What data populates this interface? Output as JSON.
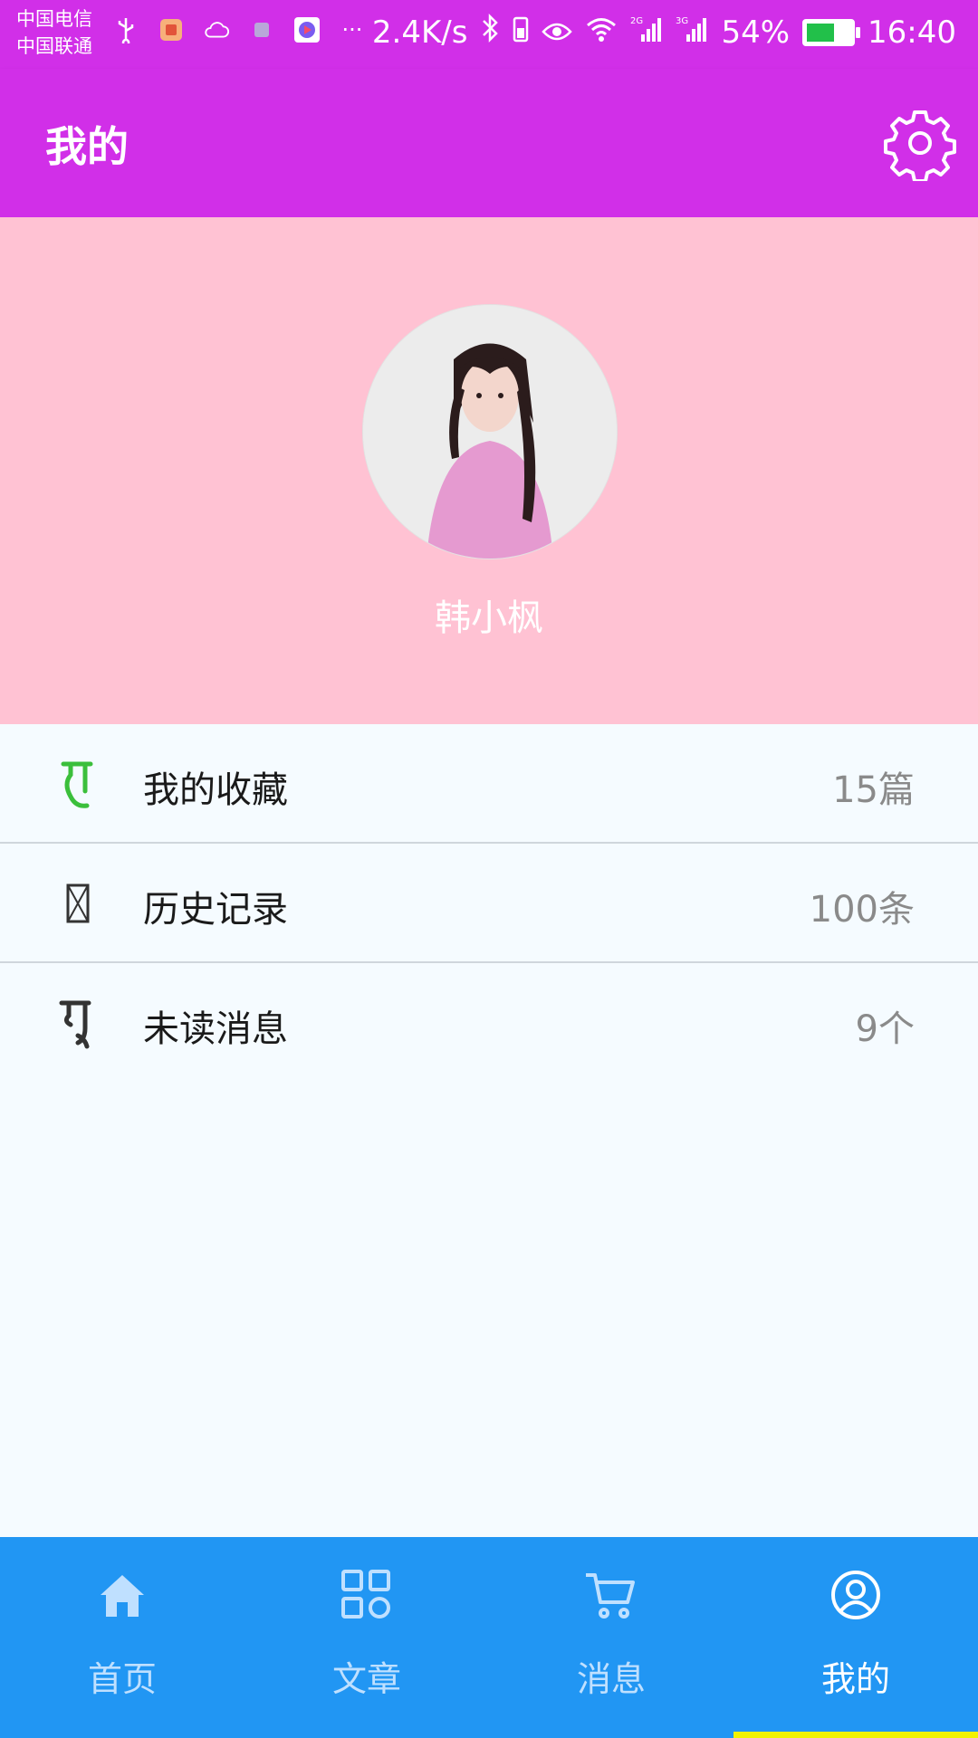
{
  "status_bar": {
    "carrier_1": "中国电信",
    "carrier_2": "中国联通",
    "speed": "2.4K/s",
    "net_2g": "2G",
    "net_3g": "3G",
    "battery": "54%",
    "time": "16:40",
    "more": "···"
  },
  "app_bar": {
    "title": "我的"
  },
  "profile": {
    "username": "韩小枫"
  },
  "menu": [
    {
      "label": "我的收藏",
      "value": "15篇",
      "icon": "favorite-icon"
    },
    {
      "label": "历史记录",
      "value": "100条",
      "icon": "history-icon"
    },
    {
      "label": "未读消息",
      "value": "9个",
      "icon": "message-icon"
    }
  ],
  "bottom_nav": [
    {
      "label": "首页",
      "icon": "home-icon"
    },
    {
      "label": "文章",
      "icon": "grid-icon"
    },
    {
      "label": "消息",
      "icon": "cart-icon"
    },
    {
      "label": "我的",
      "icon": "profile-icon"
    }
  ],
  "colors": {
    "primary": "#d12fe8",
    "profile_bg": "#ffc2d3",
    "nav_bg": "#2196f3",
    "indicator": "#f2f200",
    "favorite_icon": "#3bbf3b"
  }
}
